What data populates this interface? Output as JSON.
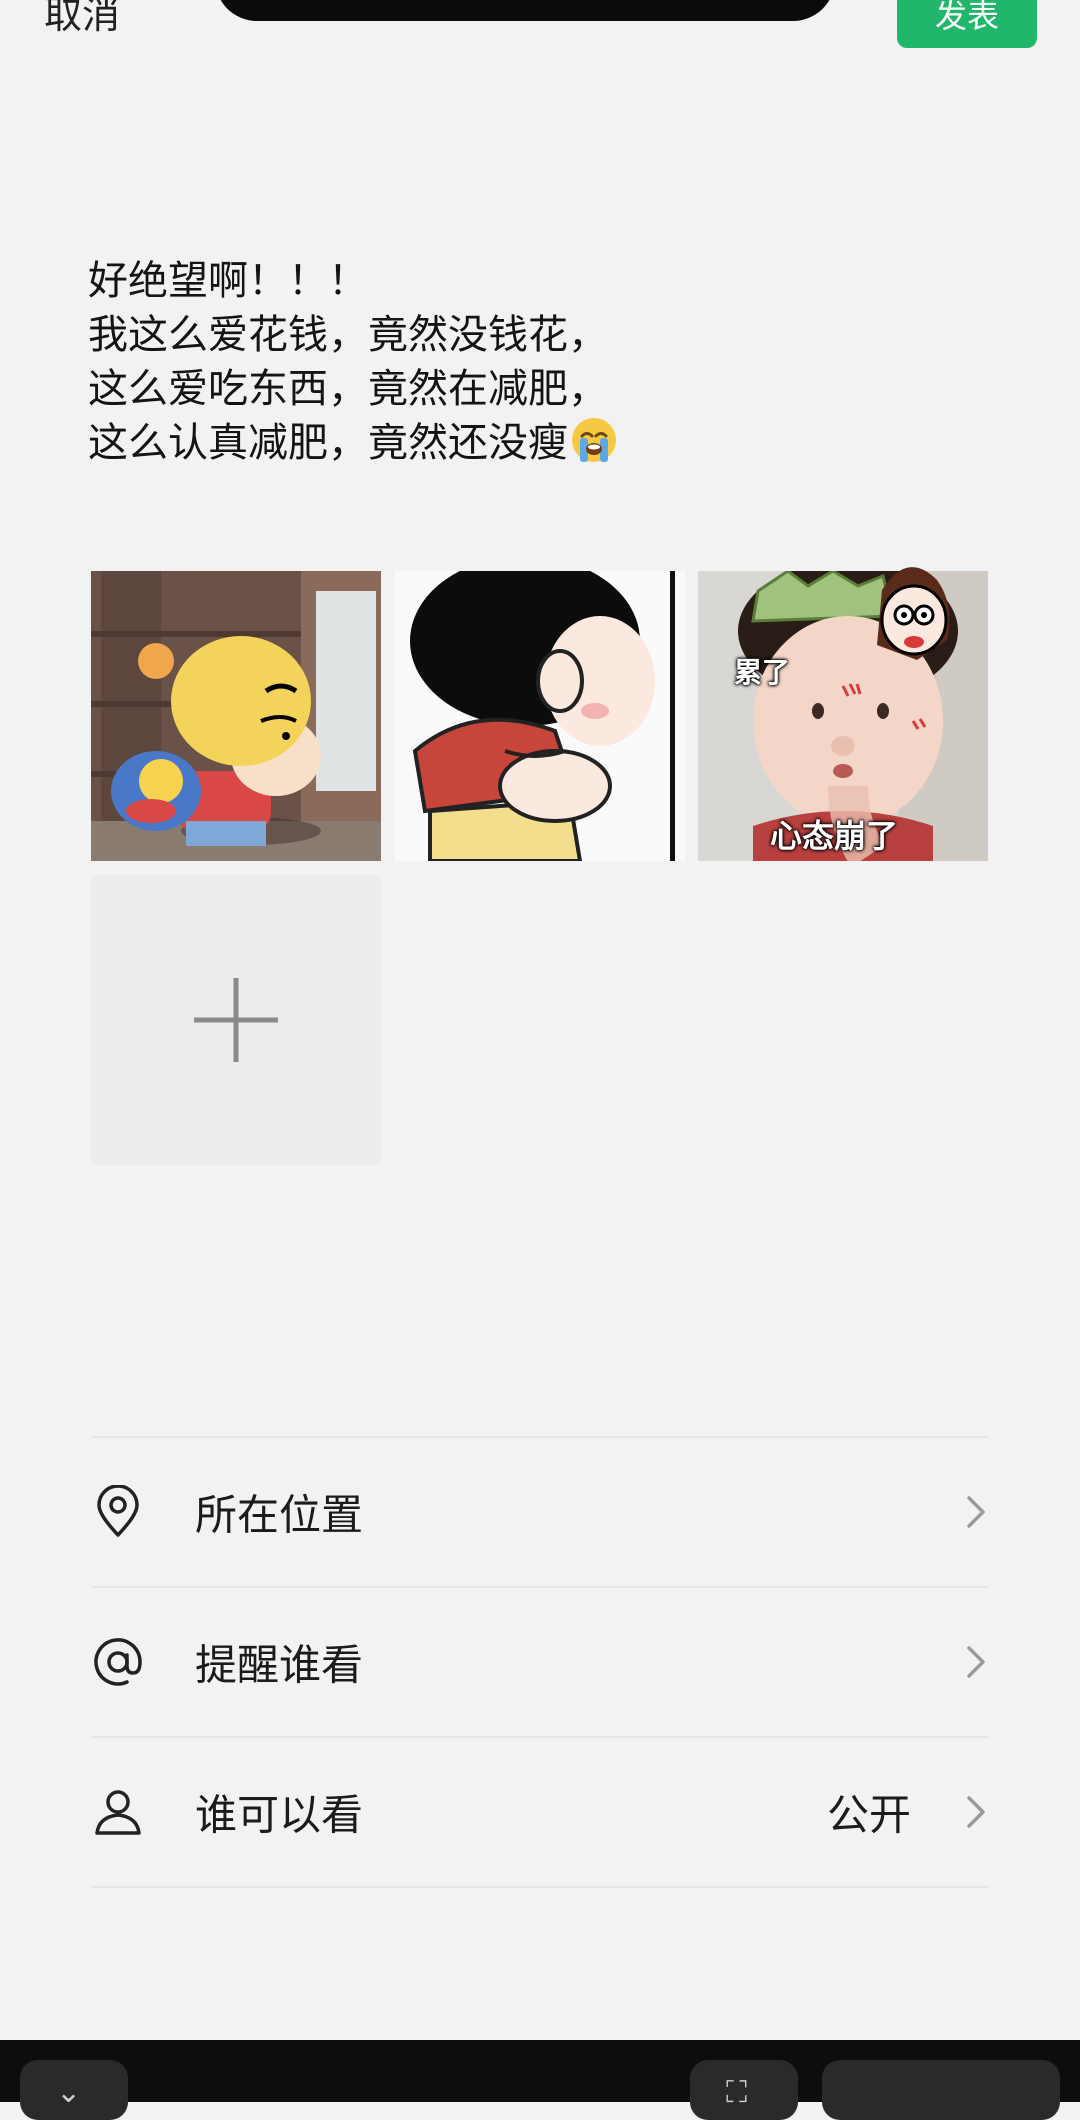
{
  "header": {
    "cancel_label": "取消",
    "publish_label": "发表"
  },
  "post": {
    "lines": [
      "好绝望啊！！！",
      "我这么爱花钱，竟然没钱花，",
      "这么爱吃东西，竟然在减肥，",
      "这么认真减肥，竟然还没瘦"
    ],
    "trailing_emoji": "loudly-crying-face-icon"
  },
  "images": [
    {
      "name": "crayon-shin-chan-backpack-sticker"
    },
    {
      "name": "crayon-shin-chan-belly-sticker"
    },
    {
      "name": "crying-baby-sticker",
      "captions": [
        "累了",
        "心态崩了"
      ]
    }
  ],
  "add_image_icon": "plus-icon",
  "settings": [
    {
      "icon": "location-pin-icon",
      "label": "所在位置",
      "value": ""
    },
    {
      "icon": "at-sign-icon",
      "label": "提醒谁看",
      "value": ""
    },
    {
      "icon": "person-icon",
      "label": "谁可以看",
      "value": "公开"
    }
  ],
  "colors": {
    "background": "#f2f2f2",
    "publish_button": "#21b76a",
    "divider": "#e6e6e6",
    "bottom_bar": "#0d0d0d"
  }
}
